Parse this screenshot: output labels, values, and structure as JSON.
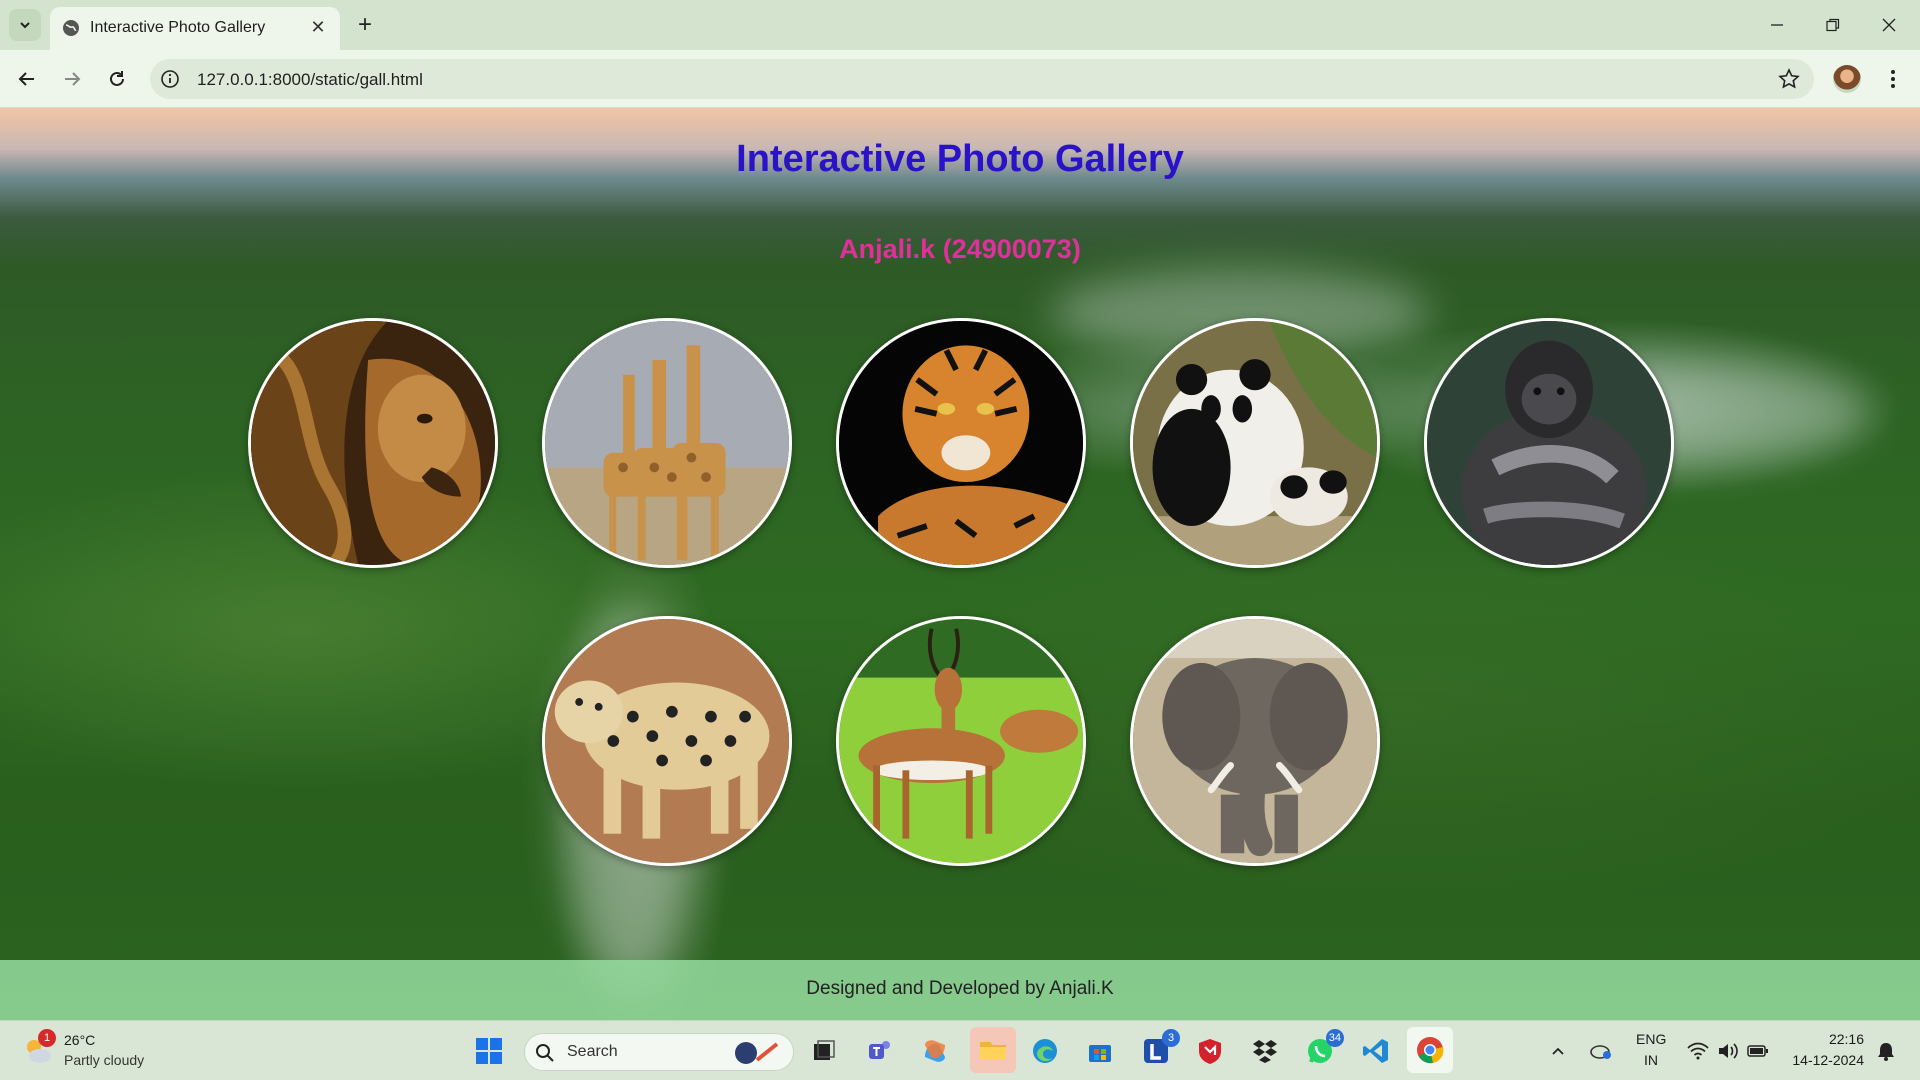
{
  "browser": {
    "tab_title": "Interactive Photo Gallery",
    "url": "127.0.0.1:8000/static/gall.html"
  },
  "page": {
    "title": "Interactive Photo Gallery",
    "subtitle": "Anjali.k (24900073)",
    "photos": [
      {
        "subject": "lion"
      },
      {
        "subject": "giraffes"
      },
      {
        "subject": "tiger"
      },
      {
        "subject": "pandas"
      },
      {
        "subject": "gorilla"
      },
      {
        "subject": "leopard"
      },
      {
        "subject": "impala"
      },
      {
        "subject": "elephant"
      }
    ],
    "footer": "Designed and Developed by Anjali.K"
  },
  "taskbar": {
    "weather": {
      "temp": "26°C",
      "desc": "Partly cloudy",
      "badge": "1"
    },
    "search_placeholder": "Search",
    "apps": [
      {
        "name": "start",
        "icon": "windows-icon"
      },
      {
        "name": "task-view",
        "icon": "task-view-icon"
      },
      {
        "name": "teams",
        "icon": "teams-icon"
      },
      {
        "name": "copilot",
        "icon": "copilot-icon"
      },
      {
        "name": "file-explorer",
        "icon": "folder-icon"
      },
      {
        "name": "edge",
        "icon": "edge-icon"
      },
      {
        "name": "store",
        "icon": "store-icon"
      },
      {
        "name": "l-app",
        "icon": "l-icon",
        "badge": "3"
      },
      {
        "name": "mcafee",
        "icon": "shield-icon"
      },
      {
        "name": "dropbox",
        "icon": "dropbox-icon"
      },
      {
        "name": "whatsapp",
        "icon": "whatsapp-icon",
        "badge": "34"
      },
      {
        "name": "vscode",
        "icon": "vscode-icon"
      },
      {
        "name": "chrome",
        "icon": "chrome-icon"
      }
    ],
    "tray": {
      "lang_top": "ENG",
      "lang_bottom": "IN",
      "time": "22:16",
      "date": "14-12-2024"
    }
  },
  "colors": {
    "title": "#2a12c9",
    "subtitle": "#e0309a",
    "footer_bg": "#96dca0"
  }
}
